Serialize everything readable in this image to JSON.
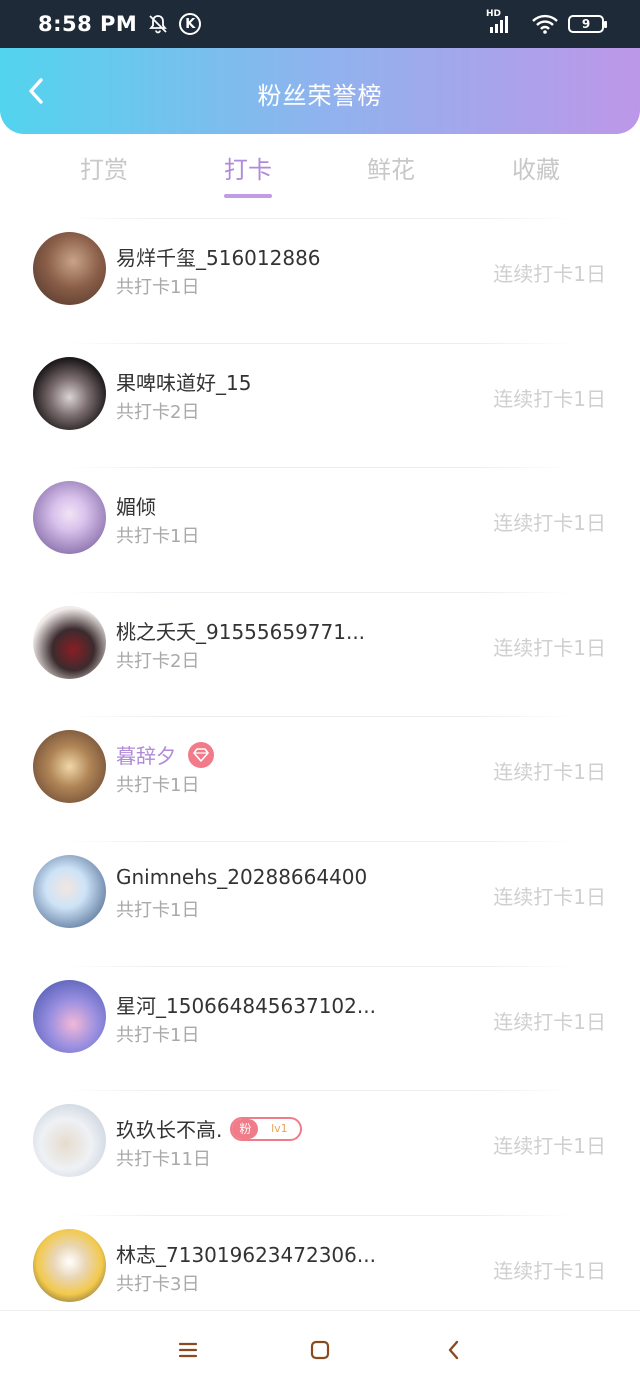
{
  "status_bar": {
    "time": "8:58 PM",
    "k_label": "K",
    "network_label": "HD",
    "battery": "9"
  },
  "header": {
    "title": "粉丝荣誉榜",
    "gradient": [
      "#52d4ee",
      "#bd97e8"
    ]
  },
  "tabs": [
    {
      "label": "打赏",
      "active": false
    },
    {
      "label": "打卡",
      "active": true
    },
    {
      "label": "鲜花",
      "active": false
    },
    {
      "label": "收藏",
      "active": false
    }
  ],
  "list": [
    {
      "name": "易烊千玺_516012886",
      "total": "共打卡1日",
      "streak": "连续打卡1日",
      "avatar_colors": [
        "#c9a38a",
        "#4a3128"
      ]
    },
    {
      "name": "果啤味道好_15",
      "total": "共打卡2日",
      "streak": "连续打卡1日",
      "avatar_colors": [
        "#d9d4d4",
        "#1f1a1c"
      ]
    },
    {
      "name": "媚倾",
      "total": "共打卡1日",
      "streak": "连续打卡1日",
      "avatar_colors": [
        "#d9c2ec",
        "#6a4f92"
      ]
    },
    {
      "name": "桃之夭夭_91555659771...",
      "total": "共打卡2日",
      "streak": "连续打卡1日",
      "avatar_colors": [
        "#f1ece9",
        "#8a1e25"
      ]
    },
    {
      "name": "暮辞夕",
      "total": "共打卡1日",
      "streak": "连续打卡1日",
      "avatar_colors": [
        "#d8b98c",
        "#5a3a2c"
      ],
      "badge": "gem"
    },
    {
      "name": "Gnimnehs_20288664400",
      "total": "共打卡1日",
      "streak": "连续打卡1日",
      "avatar_colors": [
        "#cde3f7",
        "#2f4c78"
      ]
    },
    {
      "name": "星河_150664845637102...",
      "total": "共打卡1日",
      "streak": "连续打卡1日",
      "avatar_colors": [
        "#f2b8d8",
        "#3b4ea8"
      ]
    },
    {
      "name": "玖玖长不高.",
      "total": "共打卡11日",
      "streak": "连续打卡1日",
      "avatar_colors": [
        "#eef1f5",
        "#b9c4d2"
      ],
      "badge": "fan",
      "fan_label": "粉",
      "fan_level": "lv1"
    },
    {
      "name": "林志_713019623472306...",
      "total": "共打卡3日",
      "streak": "连续打卡1日",
      "avatar_colors": [
        "#f2c94c",
        "#3a3a3a"
      ]
    }
  ],
  "bottom_nav": [
    "menu-icon",
    "home-icon",
    "back-icon"
  ],
  "colors": {
    "accent": "#b18ad8",
    "nav_icon": "#8a4a1e",
    "badge_red": "#f07b89"
  }
}
